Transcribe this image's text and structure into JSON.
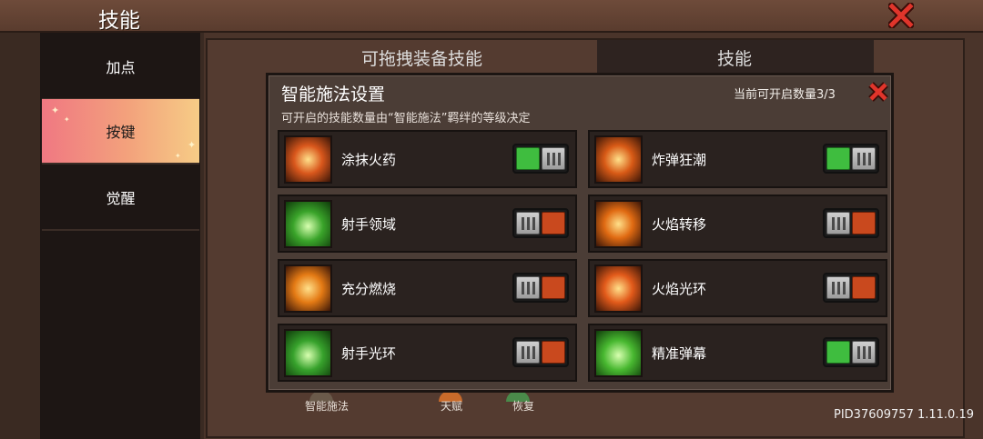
{
  "header": {
    "title": "技能"
  },
  "sidebar": {
    "tabs": [
      {
        "label": "加点",
        "active": false
      },
      {
        "label": "按键",
        "active": true
      },
      {
        "label": "觉醒",
        "active": false
      }
    ]
  },
  "background": {
    "headers": [
      "可拖拽装备技能",
      "技能"
    ],
    "bottom_labels": [
      "智能施法",
      "天赋",
      "恢复"
    ],
    "pid": "PID37609757 1.11.0.19"
  },
  "modal": {
    "title": "智能施法设置",
    "subtitle": "可开启的技能数量由“智能施法”羁绊的等级决定",
    "count_label": "当前可开启数量3/3",
    "skills": [
      {
        "name": "涂抹火药",
        "enabled": true,
        "icon": "fire-powder-icon",
        "color": "#d9571c"
      },
      {
        "name": "炸弹狂潮",
        "enabled": true,
        "icon": "bomb-frenzy-icon",
        "color": "#d85a16"
      },
      {
        "name": "射手领域",
        "enabled": false,
        "icon": "archer-domain-icon",
        "color": "#3aa42a"
      },
      {
        "name": "火焰转移",
        "enabled": false,
        "icon": "flame-transfer-icon",
        "color": "#e06a12"
      },
      {
        "name": "充分燃烧",
        "enabled": false,
        "icon": "full-burn-icon",
        "color": "#e47a14"
      },
      {
        "name": "火焰光环",
        "enabled": false,
        "icon": "flame-aura-icon",
        "color": "#e25a1a"
      },
      {
        "name": "射手光环",
        "enabled": false,
        "icon": "archer-aura-icon",
        "color": "#37a22c"
      },
      {
        "name": "精准弹幕",
        "enabled": true,
        "icon": "precise-barrage-icon",
        "color": "#48b830"
      }
    ]
  },
  "colors": {
    "toggle_on": "#3fbd3f",
    "toggle_off": "#c9491e",
    "close_red": "#e0352b"
  }
}
